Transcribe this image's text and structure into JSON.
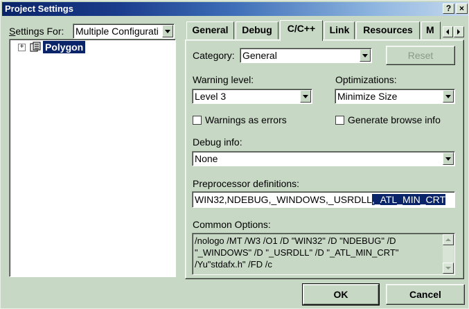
{
  "window": {
    "title": "Project Settings",
    "help_btn": "?",
    "close_btn": "×"
  },
  "left": {
    "settings_for_label": "Settings For:",
    "settings_for_value": "Multiple Configurati",
    "tree": {
      "expander": "+",
      "item": "Polygon"
    }
  },
  "tabs": [
    "General",
    "Debug",
    "C/C++",
    "Link",
    "Resources",
    "M"
  ],
  "active_tab": "C/C++",
  "panel": {
    "category_label": "Category:",
    "category_value": "General",
    "reset_label": "Reset",
    "warning_level_label": "Warning level:",
    "warning_level_value": "Level 3",
    "optimizations_label": "Optimizations:",
    "optimizations_value": "Minimize Size",
    "warnings_as_errors_label": "Warnings as errors",
    "generate_browse_label": "Generate browse info",
    "debug_info_label": "Debug info:",
    "debug_info_value": "None",
    "preproc_label": "Preprocessor definitions:",
    "preproc_value_plain": "WIN32,NDEBUG,_WINDOWS,_USRDLL",
    "preproc_value_selected": ",_ATL_MIN_CRT",
    "common_options_label": "Common Options:",
    "common_options_lines": [
      "/nologo /MT /W3 /O1 /D \"WIN32\" /D \"NDEBUG\" /D",
      "\"_WINDOWS\" /D \"_USRDLL\" /D \"_ATL_MIN_CRT\"",
      "/Yu\"stdafx.h\" /FD /c"
    ]
  },
  "footer": {
    "ok_label": "OK",
    "cancel_label": "Cancel"
  }
}
